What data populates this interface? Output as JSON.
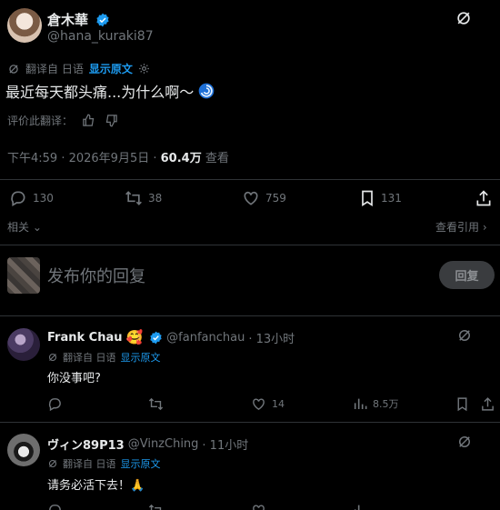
{
  "post": {
    "author_name": "倉木華",
    "author_handle": "@hana_kuraki87",
    "translated_from": "翻译自 日语",
    "show_original": "显示原文",
    "text": "最近每天都头痛...为什么啊～",
    "rate_translation": "评价此翻译：",
    "time": "下午4:59 · 2026年9月5日 · ",
    "views_count": "60.4万",
    "views_label": " 查看",
    "replies": "130",
    "reposts": "38",
    "likes": "759",
    "bookmarks": "131"
  },
  "links": {
    "related": "相关",
    "view_quotes": "查看引用"
  },
  "compose": {
    "placeholder": "发布你的回复",
    "reply_button": "回复"
  },
  "replies": [
    {
      "name": "Frank Chau",
      "handle": "@fanfanchau",
      "time": "· 13小时",
      "translated_from": "翻译自 日语",
      "show_original": "显示原文",
      "text": "你没事吧?",
      "likes": "14",
      "views": "8.5万"
    },
    {
      "name": "ヴィン89P13",
      "handle": "@VinzChing",
      "time": "· 11小时",
      "translated_from": "翻译自 日语",
      "show_original": "显示原文",
      "text": "请务必活下去！🙏",
      "likes": "",
      "views": ""
    }
  ],
  "colors": {
    "background": "#000000",
    "text": "#e7e9ea",
    "muted": "#71767b",
    "accent": "#1d9bf0",
    "divider": "#2f3336"
  }
}
